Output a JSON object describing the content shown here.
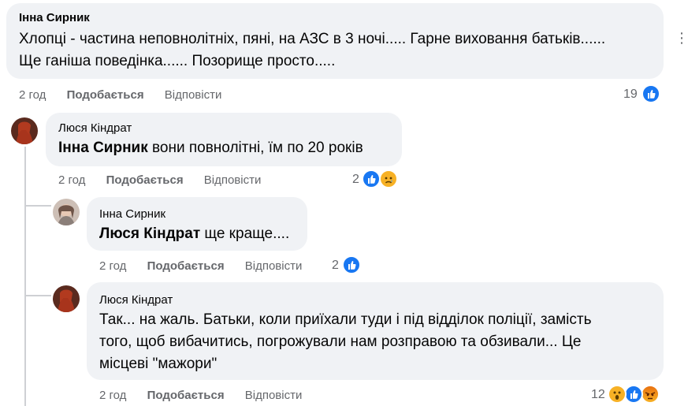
{
  "comments": [
    {
      "author": "Інна Сирник",
      "mention": "",
      "lines": [
        "Хлопці - частина неповнолітніх, пяні, на АЗС в 3 ночі..... Гарне виховання батьків......",
        "Ще ганіша поведінка...... Позорище просто....."
      ],
      "time": "2 год",
      "like_label": "Подобається",
      "reply_label": "Відповісти",
      "reaction_count": "19",
      "reactions": [
        "like-icon"
      ]
    },
    {
      "author": "Люся Кіндрат",
      "mention": "Інна Сирник",
      "lines": [
        " вони повнолітні, їм по 20 років"
      ],
      "time": "2 год",
      "like_label": "Подобається",
      "reply_label": "Відповісти",
      "reaction_count": "2",
      "reactions": [
        "like-icon",
        "sad-icon"
      ]
    },
    {
      "author": "Інна Сирник",
      "mention": "Люся Кіндрат",
      "lines": [
        " ще краще...."
      ],
      "time": "2 год",
      "like_label": "Подобається",
      "reply_label": "Відповісти",
      "reaction_count": "2",
      "reactions": [
        "like-icon"
      ]
    },
    {
      "author": "Люся Кіндрат",
      "mention": "",
      "lines": [
        "Так... на жаль. Батьки, коли приїхали туди і під відділок поліції, замість",
        "того, щоб вибачитись, погрожували нам розправою та обзивали... Це",
        "місцеві \"мажори\""
      ],
      "time": "2 год",
      "like_label": "Подобається",
      "reply_label": "Відповісти",
      "reaction_count": "12",
      "reactions": [
        "wow-icon",
        "angry-icon"
      ]
    }
  ],
  "colors": {
    "bubble": "#f0f2f5",
    "meta_text": "#65676b",
    "like_blue": "#1877f2",
    "thread_line": "#ced0d4"
  }
}
